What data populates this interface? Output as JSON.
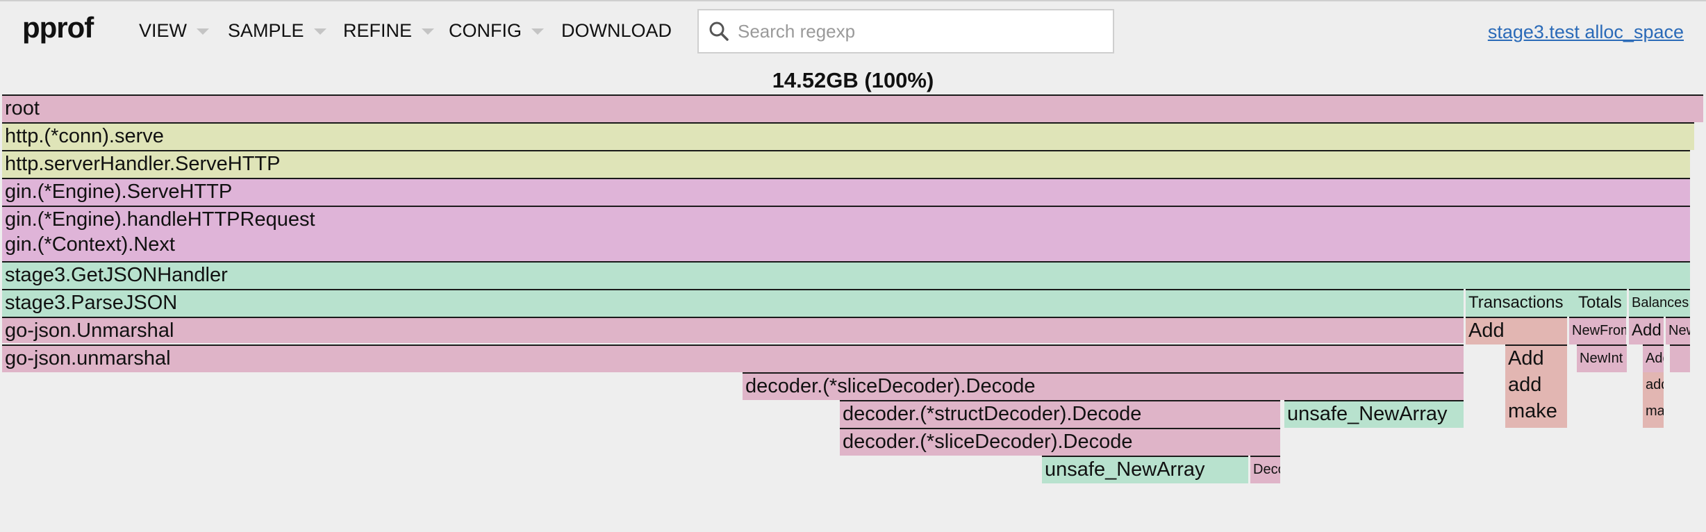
{
  "app": {
    "logo": "pprof",
    "profile_link": "stage3.test alloc_space"
  },
  "menu": {
    "view": "VIEW",
    "sample": "SAMPLE",
    "refine": "REFINE",
    "config": "CONFIG",
    "download": "DOWNLOAD"
  },
  "search": {
    "placeholder": "Search regexp",
    "value": ""
  },
  "flame": {
    "total": "14.52GB (100%)",
    "frames": {
      "root": "root",
      "conn_serve": "http.(*conn).serve",
      "server_handler": "http.serverHandler.ServeHTTP",
      "engine_serve": "gin.(*Engine).ServeHTTP",
      "engine_handle": "gin.(*Engine).handleHTTPRequest",
      "context_next": "gin.(*Context).Next",
      "get_json_handler": "stage3.GetJSONHandler",
      "parse_json": "stage3.ParseJSON",
      "transactions": "Transactions",
      "totals": "Totals",
      "balances": "Balances",
      "unmarshal_upper": "go-json.Unmarshal",
      "tx_add": "Add",
      "new_from": "NewFrom",
      "bal_add": "Add",
      "bal_new": "New",
      "unmarshal_lower": "go-json.unmarshal",
      "tx_add2": "Add",
      "new_int": "NewInt",
      "bal_add2": "Add",
      "slice_decode": "decoder.(*sliceDecoder).Decode",
      "tx_add3": "add",
      "bal_add3": "add",
      "struct_decode": "decoder.(*structDecoder).Decode",
      "unsafe_new_array_1": "unsafe_NewArray",
      "tx_make": "make",
      "bal_make": "make",
      "slice_decode_2": "decoder.(*sliceDecoder).Decode",
      "unsafe_new_array_2": "unsafe_NewArray",
      "decode_small": "Decode"
    }
  },
  "colors": {
    "pink": "#dfb4c8",
    "purple": "#dfb4d8",
    "yellow": "#dfe4b8",
    "green": "#b8e2ce",
    "salmon": "#e2b6b2",
    "link": "#2a6ab8"
  }
}
